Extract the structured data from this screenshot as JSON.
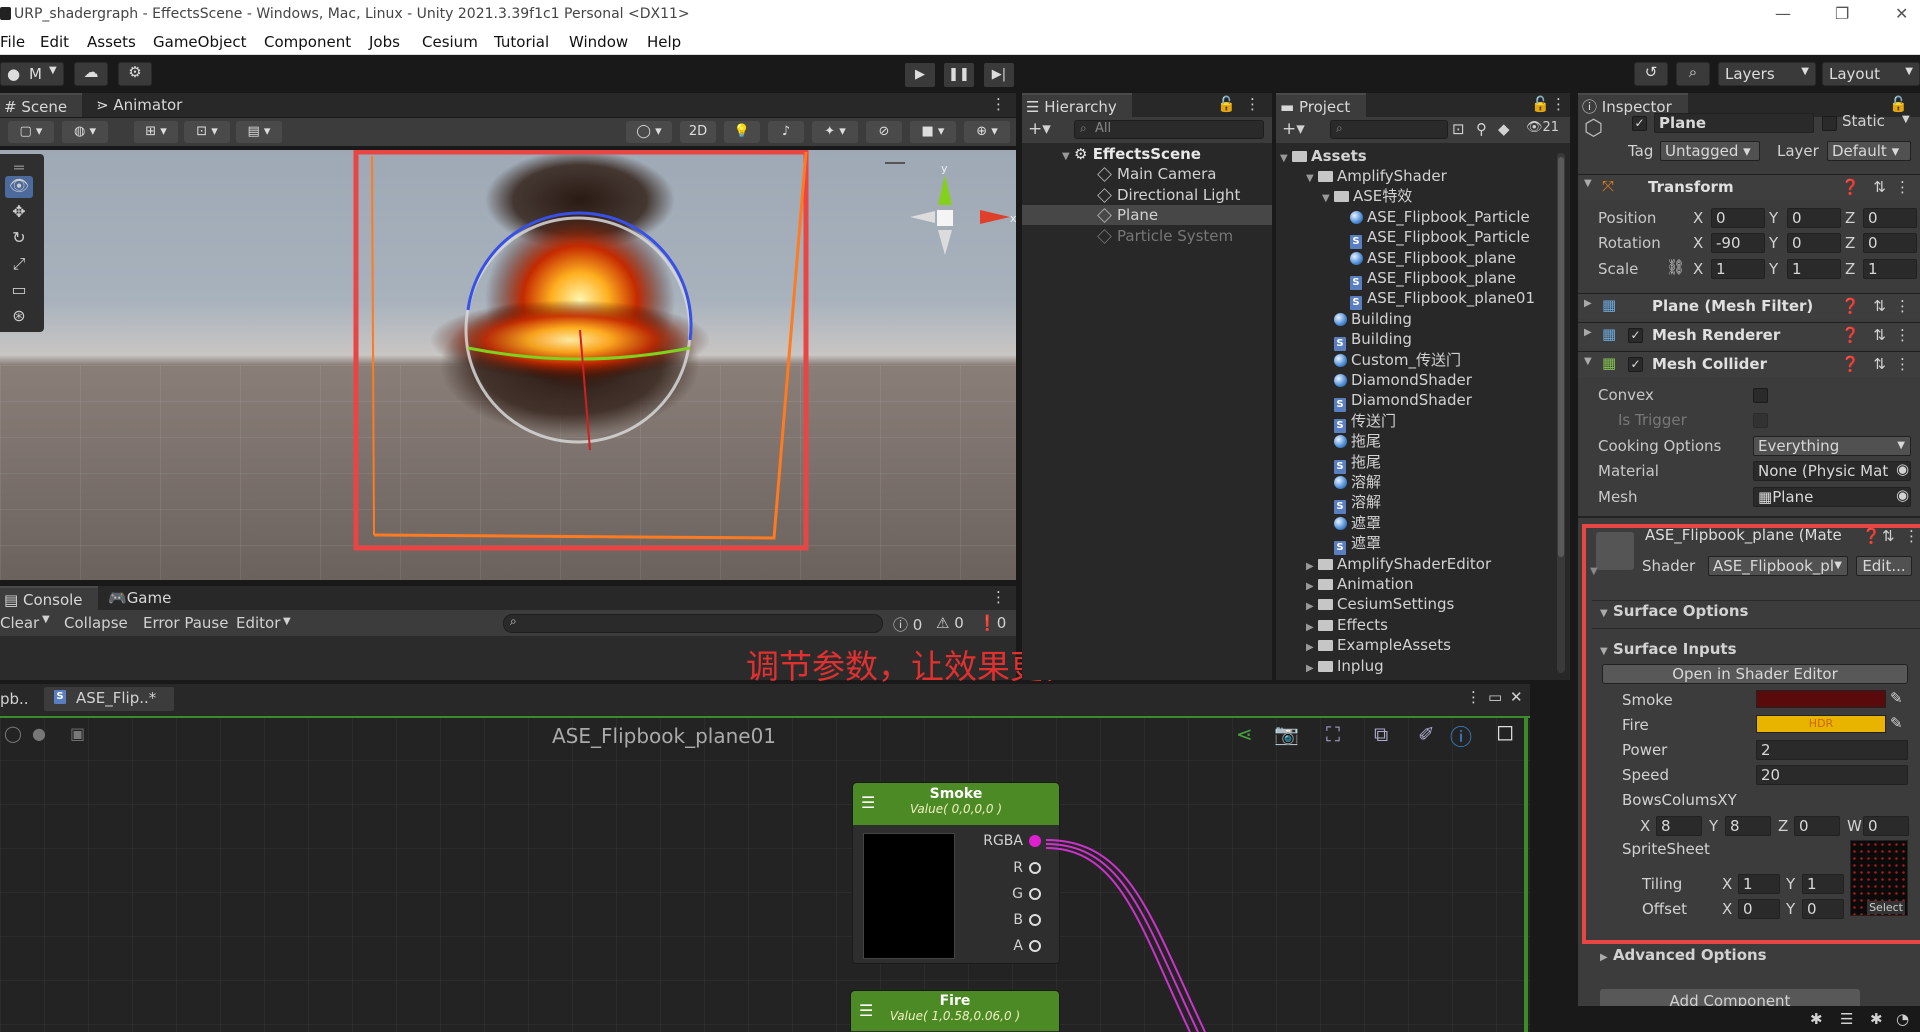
{
  "window": {
    "title": "URP_shadergraph - EffectsScene - Windows, Mac, Linux - Unity 2021.3.39f1c1 Personal <DX11>"
  },
  "menu": [
    "File",
    "Edit",
    "Assets",
    "GameObject",
    "Component",
    "Jobs",
    "Cesium",
    "Tutorial",
    "Window",
    "Help"
  ],
  "toolbar": {
    "account": "M",
    "layers": "Layers",
    "layout": "Layout"
  },
  "scene": {
    "tabs": [
      "Scene",
      "Animator"
    ],
    "mode_2d": "2D"
  },
  "console": {
    "tabs": [
      "Console",
      "Game"
    ],
    "clear": "Clear",
    "collapse": "Collapse",
    "error_pause": "Error Pause",
    "editor": "Editor",
    "count_info": "0",
    "count_warn": "0",
    "count_error": "0"
  },
  "annotation": "调节参数，让效果更佳",
  "hierarchy": {
    "tab": "Hierarchy",
    "search_placeholder": "All",
    "scene": "EffectsScene",
    "items": [
      "Main Camera",
      "Directional Light",
      "Plane",
      "Particle System"
    ]
  },
  "project": {
    "tab": "Project",
    "count": "21",
    "root": "Assets",
    "items": [
      {
        "name": "AmplifyShader",
        "kind": "folder",
        "level": 1,
        "open": true
      },
      {
        "name": "ASE特效",
        "kind": "folder",
        "level": 2,
        "open": true
      },
      {
        "name": "ASE_Flipbook_Particle",
        "kind": "mat",
        "level": 3
      },
      {
        "name": "ASE_Flipbook_Particle",
        "kind": "shader",
        "level": 3
      },
      {
        "name": "ASE_Flipbook_plane",
        "kind": "mat",
        "level": 3
      },
      {
        "name": "ASE_Flipbook_plane",
        "kind": "shader",
        "level": 3
      },
      {
        "name": "ASE_Flipbook_plane01",
        "kind": "shader",
        "level": 3
      },
      {
        "name": "Building",
        "kind": "mat",
        "level": 2
      },
      {
        "name": "Building",
        "kind": "shader",
        "level": 2
      },
      {
        "name": "Custom_传送门",
        "kind": "mat",
        "level": 2
      },
      {
        "name": "DiamondShader",
        "kind": "mat",
        "level": 2
      },
      {
        "name": "DiamondShader",
        "kind": "shader",
        "level": 2
      },
      {
        "name": "传送门",
        "kind": "shader",
        "level": 2
      },
      {
        "name": "拖尾",
        "kind": "mat",
        "level": 2
      },
      {
        "name": "拖尾",
        "kind": "shader",
        "level": 2
      },
      {
        "name": "溶解",
        "kind": "mat",
        "level": 2
      },
      {
        "name": "溶解",
        "kind": "shader",
        "level": 2
      },
      {
        "name": "遮罩",
        "kind": "mat",
        "level": 2
      },
      {
        "name": "遮罩",
        "kind": "shader",
        "level": 2
      },
      {
        "name": "AmplifyShaderEditor",
        "kind": "folder",
        "level": 1
      },
      {
        "name": "Animation",
        "kind": "folder",
        "level": 1
      },
      {
        "name": "CesiumSettings",
        "kind": "folder",
        "level": 1
      },
      {
        "name": "Effects",
        "kind": "folder",
        "level": 1
      },
      {
        "name": "ExampleAssets",
        "kind": "folder",
        "level": 1
      },
      {
        "name": "Inplug",
        "kind": "folder",
        "level": 1
      }
    ]
  },
  "inspector": {
    "tab": "Inspector",
    "object_name": "Plane",
    "static_label": "Static",
    "tag_label": "Tag",
    "tag_value": "Untagged",
    "layer_label": "Layer",
    "layer_value": "Default",
    "transform": {
      "title": "Transform",
      "position_label": "Position",
      "rotation_label": "Rotation",
      "scale_label": "Scale",
      "position": [
        "0",
        "0",
        "0"
      ],
      "rotation": [
        "-90",
        "0",
        "0"
      ],
      "scale": [
        "1",
        "1",
        "1"
      ]
    },
    "components": [
      "Plane (Mesh Filter)",
      "Mesh Renderer",
      "Mesh Collider"
    ],
    "collider": {
      "convex": "Convex",
      "is_trigger": "Is Trigger",
      "cooking_label": "Cooking Options",
      "cooking_value": "Everything",
      "material_label": "Material",
      "material_value": "None (Physic Mat",
      "mesh_label": "Mesh",
      "mesh_value": "Plane"
    },
    "material": {
      "name": "ASE_Flipbook_plane (Mate",
      "shader_label": "Shader",
      "shader_value": "ASE_Flipbook_pl",
      "edit": "Edit...",
      "surface_options": "Surface Options",
      "surface_inputs": "Surface Inputs",
      "open_editor": "Open in Shader Editor",
      "smoke_label": "Smoke",
      "smoke_color": "#5a0a0a",
      "fire_label": "Fire",
      "fire_hdr": "HDR",
      "fire_color": "#e8b400",
      "power_label": "Power",
      "power": "2",
      "speed_label": "Speed",
      "speed": "20",
      "bows_label": "BowsColumsXY",
      "bows": [
        "8",
        "8",
        "0",
        "0"
      ],
      "spritesheet_label": "SpriteSheet",
      "tiling_label": "Tiling",
      "tiling": [
        "1",
        "1"
      ],
      "offset_label": "Offset",
      "offset": [
        "0",
        "0"
      ],
      "select": "Select",
      "advanced": "Advanced Options"
    },
    "add_component": "Add Component"
  },
  "graph": {
    "tabs": [
      "pb..",
      "ASE_Flip..*"
    ],
    "title": "ASE_Flipbook_plane01",
    "smoke_node": {
      "title": "Smoke",
      "sub": "Value( 0,0,0,0 )",
      "ports": [
        "RGBA",
        "R",
        "G",
        "B",
        "A"
      ]
    },
    "fire_node": {
      "title": "Fire",
      "sub": "Value( 1,0.58,0.06,0 )"
    }
  },
  "axis_labels": {
    "y": "y",
    "x": "x"
  },
  "colors": {
    "annotation": "#e03030",
    "highlight_box": "#e84545",
    "node_header": "#4b8a24",
    "wire": "#cc33cc"
  }
}
